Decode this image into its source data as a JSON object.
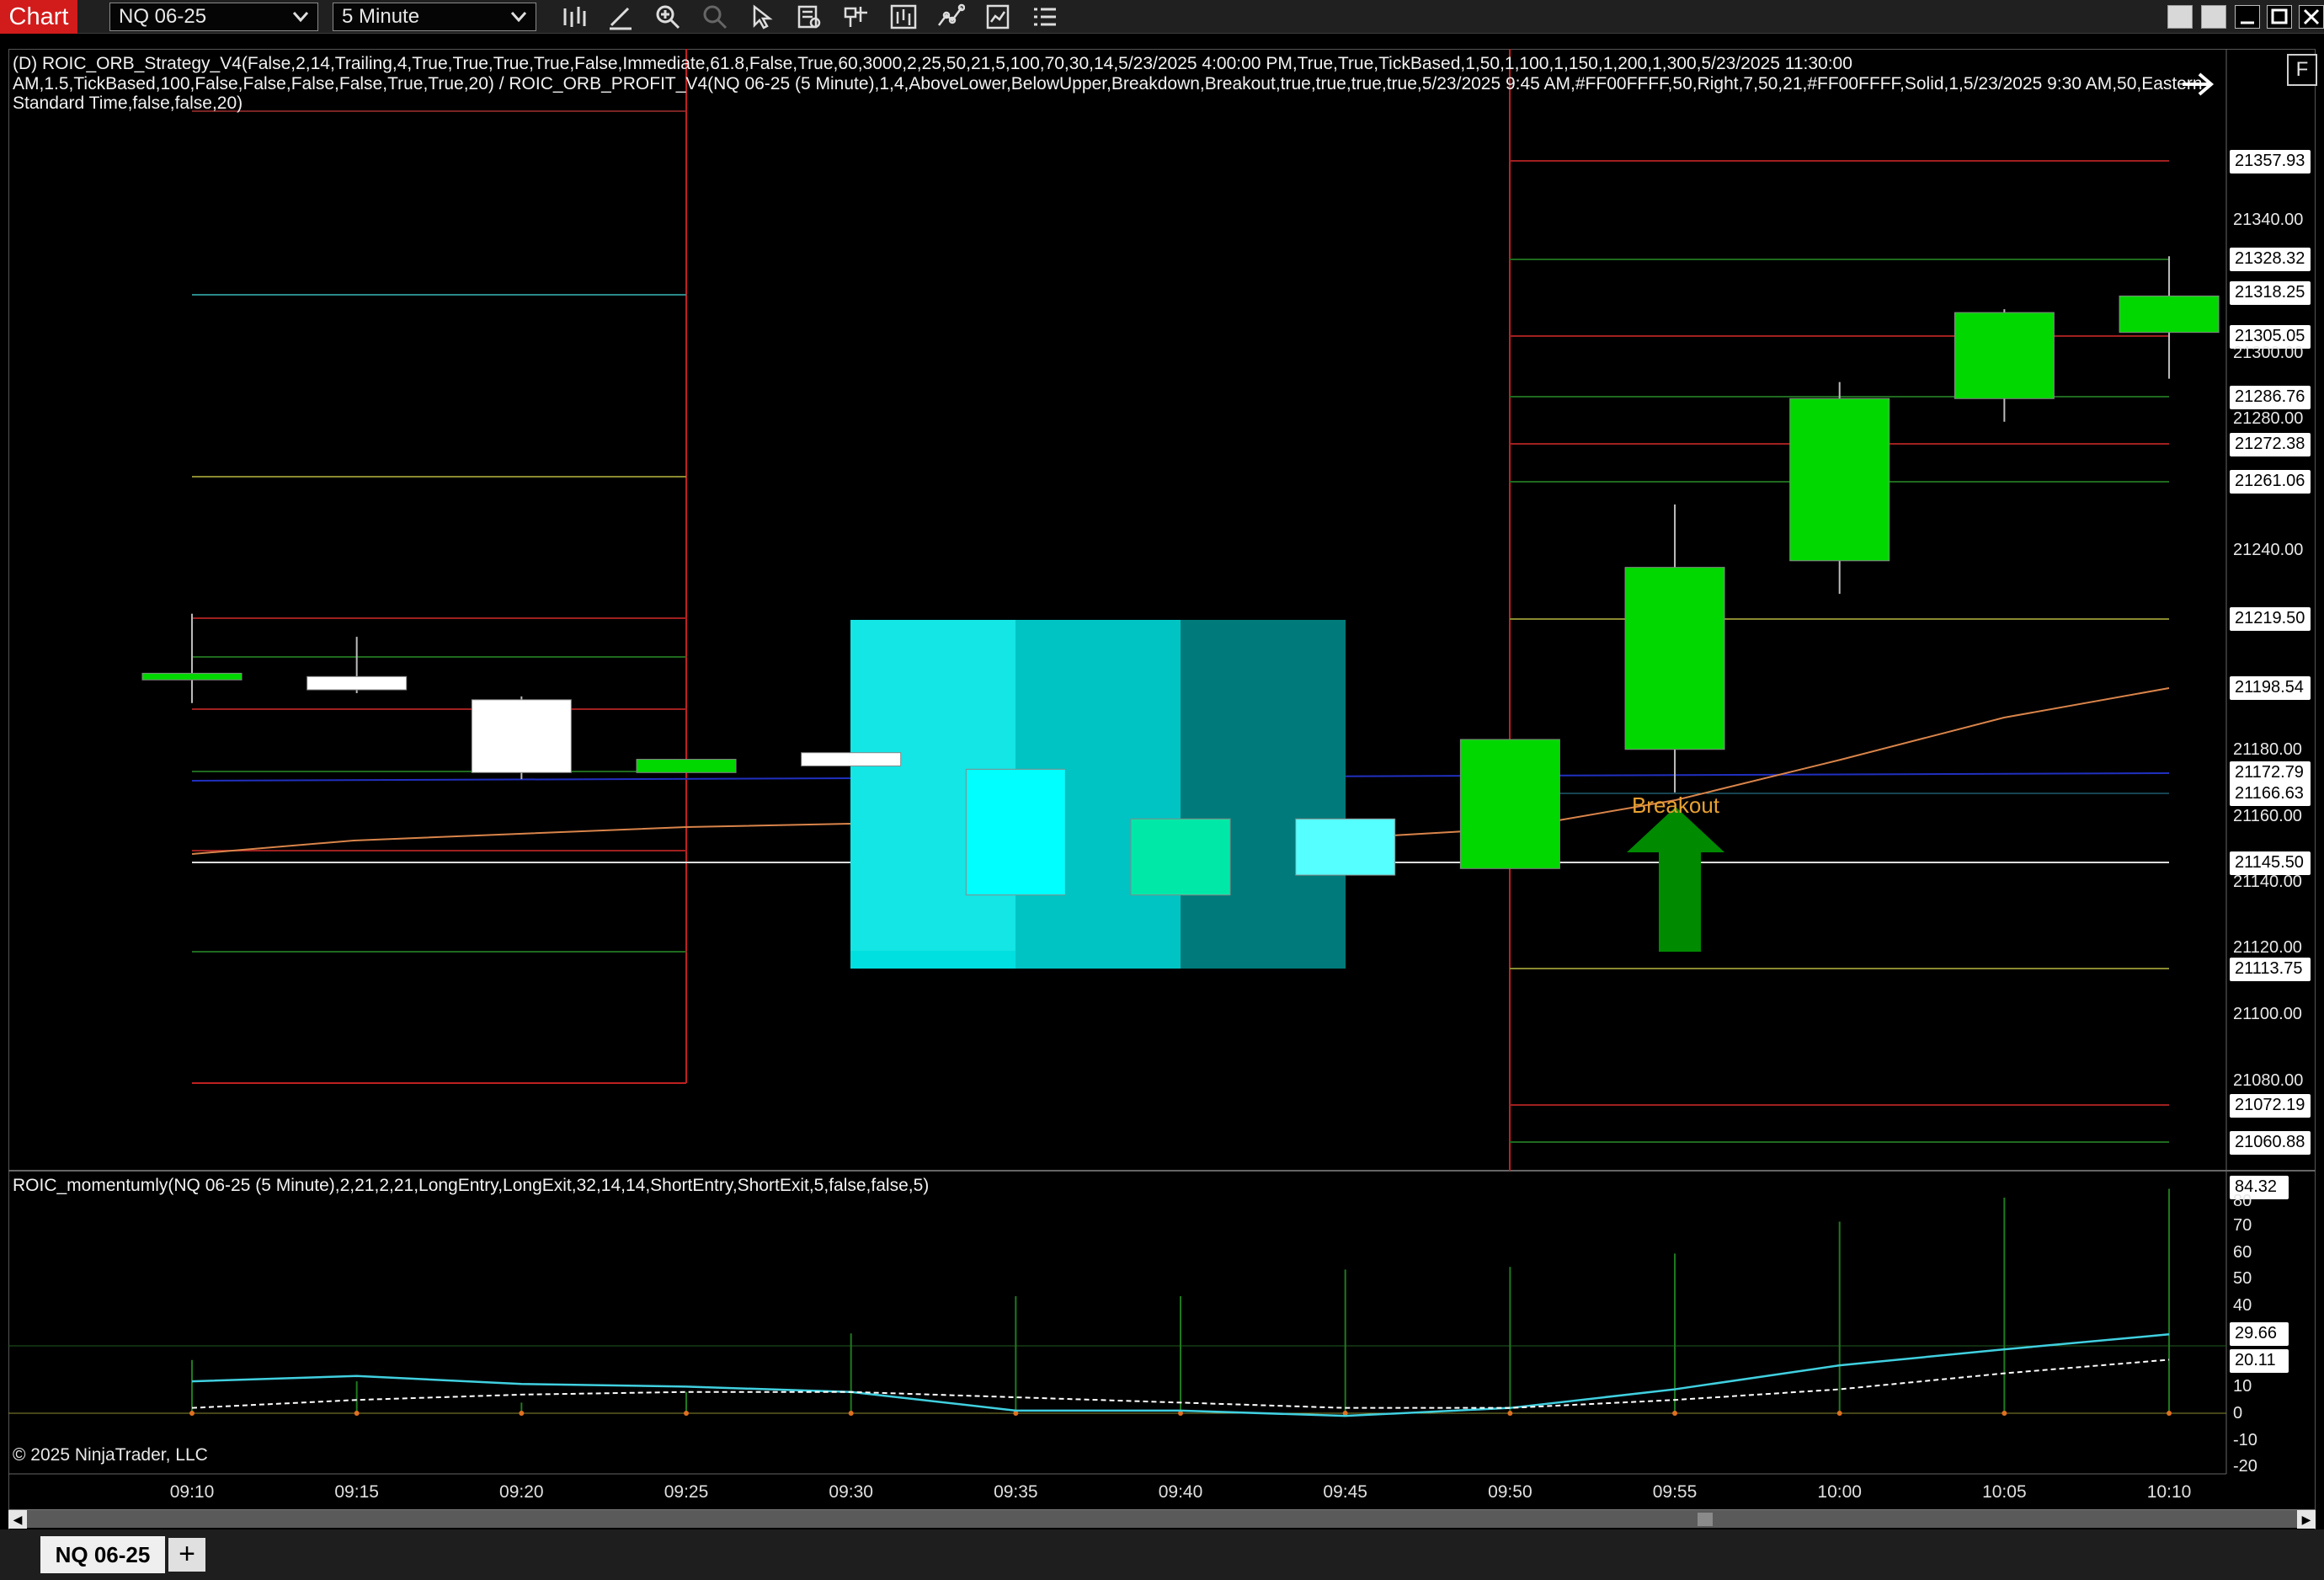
{
  "app": {
    "title": "Chart",
    "instrument": "NQ 06-25",
    "interval": "5 Minute"
  },
  "toolbar": {
    "icons": [
      "bars-icon",
      "pencil-icon",
      "zoom-in-icon",
      "zoom-out-icon",
      "cursor-icon",
      "data-box-icon",
      "strategy-icon",
      "indicator-icon",
      "drawing-icon",
      "report-icon",
      "list-icon"
    ]
  },
  "window_buttons": [
    "restore-icon",
    "restore-icon",
    "minimize-icon",
    "maximize-icon",
    "close-icon"
  ],
  "indicators": {
    "main_line1": "(D) ROIC_ORB_Strategy_V4(False,2,14,Trailing,4,True,True,True,True,False,Immediate,61.8,False,True,60,3000,2,25,50,21,5,100,70,30,14,5/23/2025 4:00:00 PM,True,True,TickBased,1,50,1,100,1,150,1,200,1,300,5/23/2025 11:30:00",
    "main_line2": "AM,1.5,TickBased,100,False,False,False,False,True,True,20) / ROIC_ORB_PROFIT_V4(NQ 06-25 (5 Minute),1,4,AboveLower,BelowUpper,Breakdown,Breakout,true,true,true,true,5/23/2025 9:45 AM,#FF00FFFF,50,Right,7,50,21,#FF00FFFF,Solid,1,5/23/2025 9:30 AM,50,Eastern",
    "main_line3": "Standard Time,false,false,20)",
    "momentum": "ROIC_momentumly(NQ 06-25 (5 Minute),2,21,2,21,LongEntry,LongExit,32,14,14,ShortEntry,ShortExit,5,false,false,5)"
  },
  "properties_label": "F",
  "copyright": "© 2025 NinjaTrader, LLC",
  "bottom_tabs": {
    "active": "NQ 06-25",
    "add_label": "+"
  },
  "colors": {
    "bull": "#00d800",
    "bear": "#ffffff",
    "cyan_zone": "#00e0e0",
    "mid_zone": "#00c4c4",
    "dark_zone": "#007a7a",
    "breakout_arrow": "#008a00",
    "breakout_text": "#e8a030"
  },
  "chart_data": {
    "type": "candlestick",
    "times": [
      "09:10",
      "09:15",
      "09:20",
      "09:25",
      "09:30",
      "09:35",
      "09:40",
      "09:45",
      "09:50",
      "09:55",
      "10:00",
      "10:05",
      "10:10"
    ],
    "price_ticks": [
      "21340.00",
      "21300.00",
      "21280.00",
      "21240.00",
      "21180.00",
      "21160.00",
      "21140.00",
      "21120.00",
      "21100.00",
      "21080.00"
    ],
    "price_levels": [
      "21357.93",
      "21328.32",
      "21318.25",
      "21305.05",
      "21286.76",
      "21272.38",
      "21261.06",
      "21219.50",
      "21198.54",
      "21172.79",
      "21166.63",
      "21145.50",
      "21113.75",
      "21072.19",
      "21060.88"
    ],
    "candles": [
      {
        "time": "09:10",
        "open": 21202,
        "high": 21222,
        "low": 21195,
        "close": 21204,
        "color": "#00d800"
      },
      {
        "time": "09:15",
        "open": 21203,
        "high": 21215,
        "low": 21198,
        "close": 21199,
        "color": "#ffffff"
      },
      {
        "time": "09:20",
        "open": 21196,
        "high": 21197,
        "low": 21172,
        "close": 21174,
        "color": "#ffffff"
      },
      {
        "time": "09:25",
        "open": 21174,
        "high": 21178,
        "low": 21174,
        "close": 21178,
        "color": "#00d800"
      },
      {
        "time": "09:30",
        "open": 21180,
        "high": 21180,
        "low": 21176,
        "close": 21176,
        "color": "#ffffff"
      },
      {
        "time": "09:35",
        "open": 21175,
        "high": 21175,
        "low": 21137,
        "close": 21137,
        "color": "#00ffff"
      },
      {
        "time": "09:40",
        "open": 21160,
        "high": 21160,
        "low": 21137,
        "close": 21137,
        "color": "#00e8a8"
      },
      {
        "time": "09:45",
        "open": 21160,
        "high": 21160,
        "low": 21143,
        "close": 21143,
        "color": "#55ffff"
      },
      {
        "time": "09:50",
        "open": 21145,
        "high": 21184,
        "low": 21145,
        "close": 21184,
        "color": "#00d800"
      },
      {
        "time": "09:55",
        "open": 21181,
        "high": 21255,
        "low": 21168,
        "close": 21236,
        "color": "#00d800"
      },
      {
        "time": "10:00",
        "open": 21238,
        "high": 21292,
        "low": 21228,
        "close": 21287,
        "color": "#00d800"
      },
      {
        "time": "10:05",
        "open": 21287,
        "high": 21314,
        "low": 21280,
        "close": 21313,
        "color": "#00d800"
      },
      {
        "time": "10:10",
        "open": 21307,
        "high": 21330,
        "low": 21293,
        "close": 21318,
        "color": "#00d800"
      }
    ],
    "annotations": [
      {
        "text": "Breakout",
        "time": "09:55"
      }
    ],
    "momentum": {
      "ticks": [
        "80",
        "70",
        "60",
        "50",
        "40",
        "10",
        "0",
        "-10",
        "-20"
      ],
      "boxed": [
        "84.32",
        "29.66",
        "20.11",
        "0"
      ],
      "fast": [
        12,
        14,
        11,
        10,
        8,
        1,
        1,
        -1,
        2,
        9,
        18,
        24,
        29.66
      ],
      "slow": [
        2,
        5,
        7,
        8,
        8,
        6,
        4,
        2,
        2,
        5,
        9,
        15,
        20.11
      ]
    }
  }
}
